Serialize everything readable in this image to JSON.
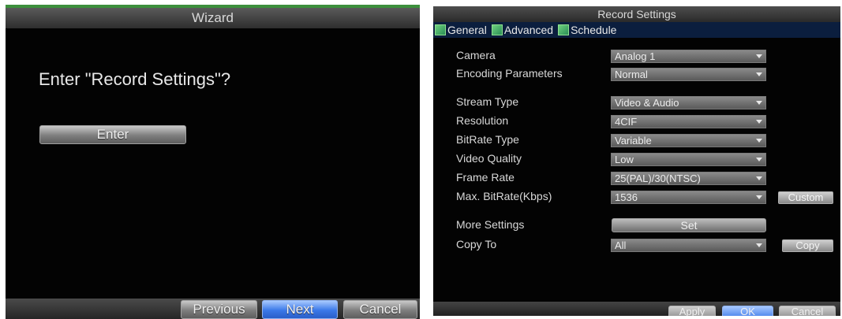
{
  "wizard": {
    "title": "Wizard",
    "question": "Enter \"Record Settings\"?",
    "enter_label": "Enter",
    "previous_label": "Previous",
    "next_label": "Next",
    "cancel_label": "Cancel"
  },
  "record": {
    "title": "Record Settings",
    "tabs": [
      {
        "label": "General"
      },
      {
        "label": "Advanced"
      },
      {
        "label": "Schedule"
      }
    ],
    "fields": {
      "camera": {
        "label": "Camera",
        "value": "Analog 1"
      },
      "encoding": {
        "label": "Encoding Parameters",
        "value": "Normal"
      },
      "stream_type": {
        "label": "Stream Type",
        "value": "Video & Audio"
      },
      "resolution": {
        "label": "Resolution",
        "value": "4CIF"
      },
      "bitrate_type": {
        "label": "BitRate Type",
        "value": "Variable"
      },
      "video_quality": {
        "label": "Video Quality",
        "value": "Low"
      },
      "frame_rate": {
        "label": "Frame Rate",
        "value": "25(PAL)/30(NTSC)"
      },
      "max_bitrate": {
        "label": "Max. BitRate(Kbps)",
        "value": "1536"
      },
      "more_settings": {
        "label": "More Settings"
      },
      "copy_to": {
        "label": "Copy To",
        "value": "All"
      }
    },
    "custom_label": "Custom",
    "set_label": "Set",
    "copy_label": "Copy",
    "apply_label": "Apply",
    "ok_label": "OK",
    "cancel_label": "Cancel"
  },
  "colors": {
    "accent_green": "#3c8f3c",
    "selected_blue": "#3b78e8",
    "tab_bar": "#0b1e3e"
  }
}
